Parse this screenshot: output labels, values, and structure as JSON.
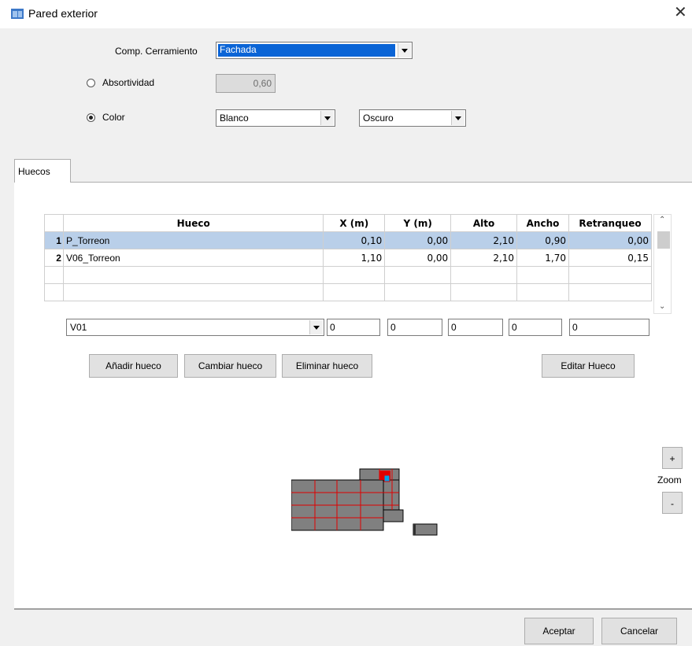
{
  "window": {
    "title": "Pared exterior",
    "close_label": "✕"
  },
  "form": {
    "comp_label": "Comp. Cerramiento",
    "comp_value": "Fachada",
    "absortividad_label": "Absortividad",
    "absortividad_value": "0,60",
    "absortividad_selected": false,
    "color_label": "Color",
    "color_selected": true,
    "color_value": "Blanco",
    "tone_value": "Oscuro"
  },
  "tabs": [
    {
      "label": "Huecos",
      "active": true
    }
  ],
  "table": {
    "columns": [
      "",
      "Hueco",
      "X (m)",
      "Y (m)",
      "Alto",
      "Ancho",
      "Retranqueo"
    ],
    "rows": [
      {
        "n": "1",
        "hueco": "P_Torreon",
        "x": "0,10",
        "y": "0,00",
        "alto": "2,10",
        "ancho": "0,90",
        "retranqueo": "0,00",
        "selected": true
      },
      {
        "n": "2",
        "hueco": "V06_Torreon",
        "x": "1,10",
        "y": "0,00",
        "alto": "2,10",
        "ancho": "1,70",
        "retranqueo": "0,15",
        "selected": false
      }
    ]
  },
  "editor": {
    "hueco": "V01",
    "x": "0",
    "y": "0",
    "alto": "0",
    "ancho": "0",
    "retranqueo": "0"
  },
  "buttons": {
    "add": "Añadir hueco",
    "change": "Cambiar hueco",
    "delete": "Eliminar hueco",
    "edit": "Editar Hueco",
    "zoom_in": "+",
    "zoom_label": "Zoom",
    "zoom_out": "-",
    "accept": "Aceptar",
    "cancel": "Cancelar"
  },
  "colors": {
    "selection": "#0a64d6",
    "row_selected": "#b9cfe9",
    "wall_fill": "#808080",
    "grid_lines": "#e00000",
    "window_blue": "#00a2e8"
  }
}
